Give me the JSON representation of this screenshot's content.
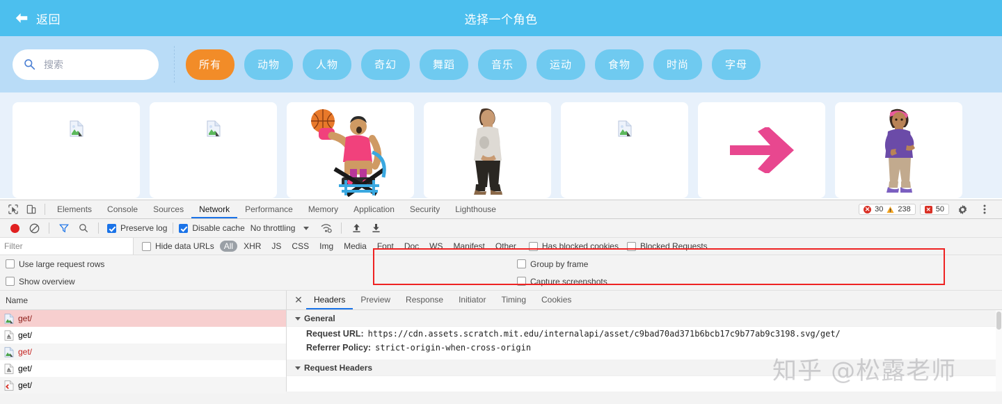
{
  "library": {
    "back_label": "返回",
    "title": "选择一个角色",
    "search": {
      "placeholder": "搜索",
      "value": ""
    },
    "categories": [
      {
        "label": "所有",
        "active": true
      },
      {
        "label": "动物",
        "active": false
      },
      {
        "label": "人物",
        "active": false
      },
      {
        "label": "奇幻",
        "active": false
      },
      {
        "label": "舞蹈",
        "active": false
      },
      {
        "label": "音乐",
        "active": false
      },
      {
        "label": "运动",
        "active": false
      },
      {
        "label": "食物",
        "active": false
      },
      {
        "label": "时尚",
        "active": false
      },
      {
        "label": "字母",
        "active": false
      }
    ],
    "sprites": [
      {
        "kind": "broken"
      },
      {
        "kind": "broken"
      },
      {
        "kind": "basketball-player"
      },
      {
        "kind": "standing-person"
      },
      {
        "kind": "broken"
      },
      {
        "kind": "arrow"
      },
      {
        "kind": "girl-character"
      }
    ]
  },
  "devtools": {
    "tabs": [
      {
        "label": "Elements",
        "selected": false
      },
      {
        "label": "Console",
        "selected": false
      },
      {
        "label": "Sources",
        "selected": false
      },
      {
        "label": "Network",
        "selected": true
      },
      {
        "label": "Performance",
        "selected": false
      },
      {
        "label": "Memory",
        "selected": false
      },
      {
        "label": "Application",
        "selected": false
      },
      {
        "label": "Security",
        "selected": false
      },
      {
        "label": "Lighthouse",
        "selected": false
      }
    ],
    "counters": {
      "errors": "30",
      "warnings": "238",
      "violations": "50"
    },
    "toolbar": {
      "preserve_log": {
        "label": "Preserve log",
        "checked": true
      },
      "disable_cache": {
        "label": "Disable cache",
        "checked": true
      },
      "throttling": "No throttling"
    },
    "filter_row": {
      "filter_placeholder": "Filter",
      "hide_data_urls": {
        "label": "Hide data URLs",
        "checked": false
      },
      "types": [
        "All",
        "XHR",
        "JS",
        "CSS",
        "Img",
        "Media",
        "Font",
        "Doc",
        "WS",
        "Manifest",
        "Other"
      ],
      "selected_type": "All",
      "has_blocked_cookies": {
        "label": "Has blocked cookies",
        "checked": false
      },
      "blocked_requests": {
        "label": "Blocked Requests",
        "checked": false
      }
    },
    "options": {
      "use_large_request_rows": {
        "label": "Use large request rows",
        "checked": false
      },
      "show_overview": {
        "label": "Show overview",
        "checked": false
      },
      "group_by_frame": {
        "label": "Group by frame",
        "checked": false
      },
      "capture_screenshots": {
        "label": "Capture screenshots",
        "checked": false
      }
    },
    "request_list": {
      "column_header": "Name",
      "rows": [
        {
          "name": "get/",
          "icon": "image-icon",
          "state": "selected-error"
        },
        {
          "name": "get/",
          "icon": "script-icon",
          "state": "normal"
        },
        {
          "name": "get/",
          "icon": "image-icon",
          "state": "error"
        },
        {
          "name": "get/",
          "icon": "script-icon",
          "state": "normal"
        },
        {
          "name": "get/",
          "icon": "redirect-icon",
          "state": "normal"
        }
      ]
    },
    "detail": {
      "tabs": [
        {
          "label": "Headers",
          "selected": true
        },
        {
          "label": "Preview",
          "selected": false
        },
        {
          "label": "Response",
          "selected": false
        },
        {
          "label": "Initiator",
          "selected": false
        },
        {
          "label": "Timing",
          "selected": false
        },
        {
          "label": "Cookies",
          "selected": false
        }
      ],
      "general_title": "General",
      "request_url_key": "Request URL:",
      "request_url_value": "https://cdn.assets.scratch.mit.edu/internalapi/asset/c9bad70ad371b6bcb17c9b77ab9c3198.svg/get/",
      "referrer_policy_key": "Referrer Policy:",
      "referrer_policy_value": "strict-origin-when-cross-origin",
      "request_headers_title": "Request Headers"
    }
  },
  "watermark": {
    "text": "知乎 @松露老师"
  },
  "colors": {
    "header_blue": "#4cbfee",
    "filterbar_blue": "#b9dcf7",
    "pill_blue": "#6fcaf0",
    "pill_active_orange": "#f28c28",
    "grid_bg": "#e8f1fb",
    "devtools_accent": "#1a73e8",
    "error_red": "#d93025",
    "highlight_red": "#ee2222",
    "arrow_pink": "#e8478f"
  }
}
